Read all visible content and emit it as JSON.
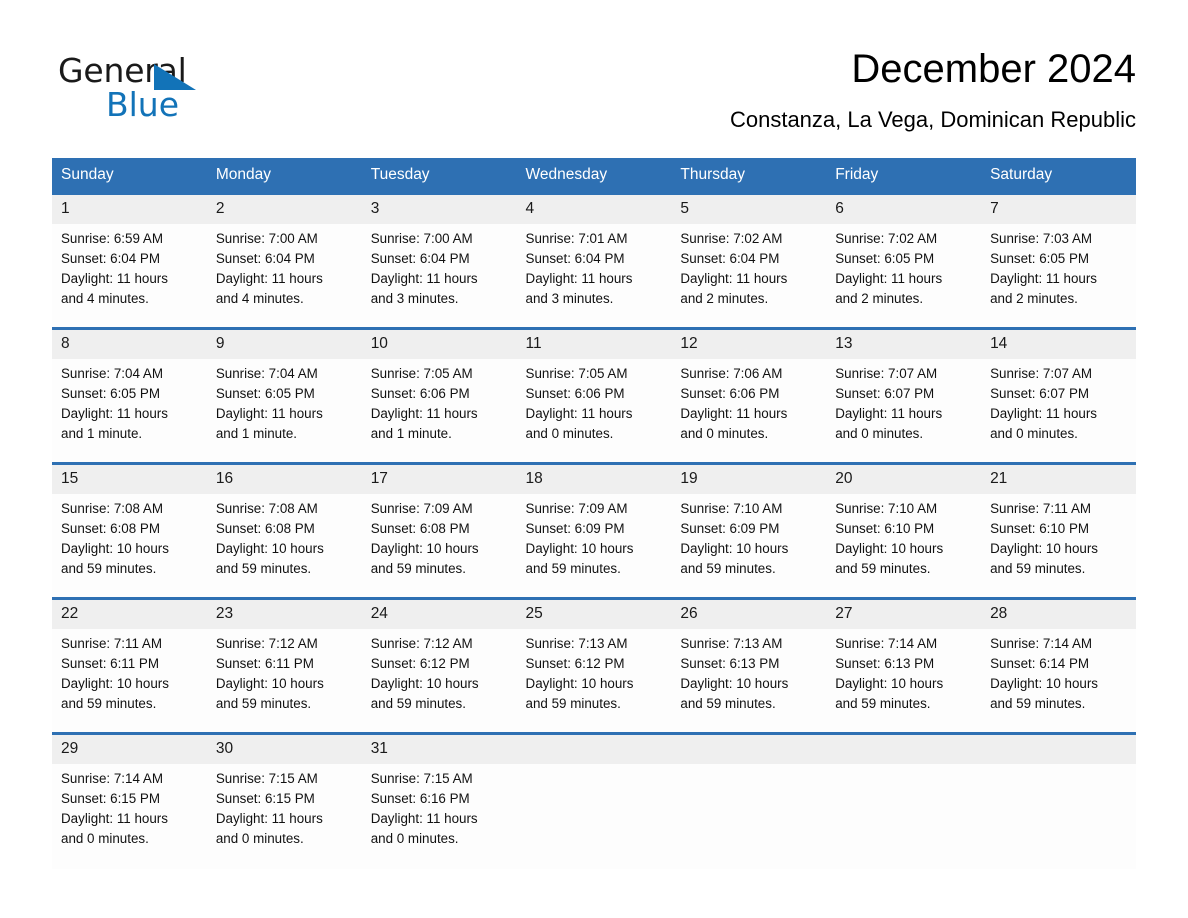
{
  "brand": {
    "name_top": "General",
    "name_bottom": "Blue",
    "triangle_icon": "triangle-logo-icon",
    "accent_color": "#1273b8"
  },
  "header": {
    "title": "December 2024",
    "subtitle": "Constanza, La Vega, Dominican Republic"
  },
  "theme": {
    "header_blue": "#2e70b3",
    "daynum_band": "#efefef",
    "cell_background": "#fdfdfd"
  },
  "weekdays": [
    "Sunday",
    "Monday",
    "Tuesday",
    "Wednesday",
    "Thursday",
    "Friday",
    "Saturday"
  ],
  "weeks": [
    [
      {
        "day": "1",
        "sunrise": "Sunrise: 6:59 AM",
        "sunset": "Sunset: 6:04 PM",
        "daylight1": "Daylight: 11 hours",
        "daylight2": "and 4 minutes."
      },
      {
        "day": "2",
        "sunrise": "Sunrise: 7:00 AM",
        "sunset": "Sunset: 6:04 PM",
        "daylight1": "Daylight: 11 hours",
        "daylight2": "and 4 minutes."
      },
      {
        "day": "3",
        "sunrise": "Sunrise: 7:00 AM",
        "sunset": "Sunset: 6:04 PM",
        "daylight1": "Daylight: 11 hours",
        "daylight2": "and 3 minutes."
      },
      {
        "day": "4",
        "sunrise": "Sunrise: 7:01 AM",
        "sunset": "Sunset: 6:04 PM",
        "daylight1": "Daylight: 11 hours",
        "daylight2": "and 3 minutes."
      },
      {
        "day": "5",
        "sunrise": "Sunrise: 7:02 AM",
        "sunset": "Sunset: 6:04 PM",
        "daylight1": "Daylight: 11 hours",
        "daylight2": "and 2 minutes."
      },
      {
        "day": "6",
        "sunrise": "Sunrise: 7:02 AM",
        "sunset": "Sunset: 6:05 PM",
        "daylight1": "Daylight: 11 hours",
        "daylight2": "and 2 minutes."
      },
      {
        "day": "7",
        "sunrise": "Sunrise: 7:03 AM",
        "sunset": "Sunset: 6:05 PM",
        "daylight1": "Daylight: 11 hours",
        "daylight2": "and 2 minutes."
      }
    ],
    [
      {
        "day": "8",
        "sunrise": "Sunrise: 7:04 AM",
        "sunset": "Sunset: 6:05 PM",
        "daylight1": "Daylight: 11 hours",
        "daylight2": "and 1 minute."
      },
      {
        "day": "9",
        "sunrise": "Sunrise: 7:04 AM",
        "sunset": "Sunset: 6:05 PM",
        "daylight1": "Daylight: 11 hours",
        "daylight2": "and 1 minute."
      },
      {
        "day": "10",
        "sunrise": "Sunrise: 7:05 AM",
        "sunset": "Sunset: 6:06 PM",
        "daylight1": "Daylight: 11 hours",
        "daylight2": "and 1 minute."
      },
      {
        "day": "11",
        "sunrise": "Sunrise: 7:05 AM",
        "sunset": "Sunset: 6:06 PM",
        "daylight1": "Daylight: 11 hours",
        "daylight2": "and 0 minutes."
      },
      {
        "day": "12",
        "sunrise": "Sunrise: 7:06 AM",
        "sunset": "Sunset: 6:06 PM",
        "daylight1": "Daylight: 11 hours",
        "daylight2": "and 0 minutes."
      },
      {
        "day": "13",
        "sunrise": "Sunrise: 7:07 AM",
        "sunset": "Sunset: 6:07 PM",
        "daylight1": "Daylight: 11 hours",
        "daylight2": "and 0 minutes."
      },
      {
        "day": "14",
        "sunrise": "Sunrise: 7:07 AM",
        "sunset": "Sunset: 6:07 PM",
        "daylight1": "Daylight: 11 hours",
        "daylight2": "and 0 minutes."
      }
    ],
    [
      {
        "day": "15",
        "sunrise": "Sunrise: 7:08 AM",
        "sunset": "Sunset: 6:08 PM",
        "daylight1": "Daylight: 10 hours",
        "daylight2": "and 59 minutes."
      },
      {
        "day": "16",
        "sunrise": "Sunrise: 7:08 AM",
        "sunset": "Sunset: 6:08 PM",
        "daylight1": "Daylight: 10 hours",
        "daylight2": "and 59 minutes."
      },
      {
        "day": "17",
        "sunrise": "Sunrise: 7:09 AM",
        "sunset": "Sunset: 6:08 PM",
        "daylight1": "Daylight: 10 hours",
        "daylight2": "and 59 minutes."
      },
      {
        "day": "18",
        "sunrise": "Sunrise: 7:09 AM",
        "sunset": "Sunset: 6:09 PM",
        "daylight1": "Daylight: 10 hours",
        "daylight2": "and 59 minutes."
      },
      {
        "day": "19",
        "sunrise": "Sunrise: 7:10 AM",
        "sunset": "Sunset: 6:09 PM",
        "daylight1": "Daylight: 10 hours",
        "daylight2": "and 59 minutes."
      },
      {
        "day": "20",
        "sunrise": "Sunrise: 7:10 AM",
        "sunset": "Sunset: 6:10 PM",
        "daylight1": "Daylight: 10 hours",
        "daylight2": "and 59 minutes."
      },
      {
        "day": "21",
        "sunrise": "Sunrise: 7:11 AM",
        "sunset": "Sunset: 6:10 PM",
        "daylight1": "Daylight: 10 hours",
        "daylight2": "and 59 minutes."
      }
    ],
    [
      {
        "day": "22",
        "sunrise": "Sunrise: 7:11 AM",
        "sunset": "Sunset: 6:11 PM",
        "daylight1": "Daylight: 10 hours",
        "daylight2": "and 59 minutes."
      },
      {
        "day": "23",
        "sunrise": "Sunrise: 7:12 AM",
        "sunset": "Sunset: 6:11 PM",
        "daylight1": "Daylight: 10 hours",
        "daylight2": "and 59 minutes."
      },
      {
        "day": "24",
        "sunrise": "Sunrise: 7:12 AM",
        "sunset": "Sunset: 6:12 PM",
        "daylight1": "Daylight: 10 hours",
        "daylight2": "and 59 minutes."
      },
      {
        "day": "25",
        "sunrise": "Sunrise: 7:13 AM",
        "sunset": "Sunset: 6:12 PM",
        "daylight1": "Daylight: 10 hours",
        "daylight2": "and 59 minutes."
      },
      {
        "day": "26",
        "sunrise": "Sunrise: 7:13 AM",
        "sunset": "Sunset: 6:13 PM",
        "daylight1": "Daylight: 10 hours",
        "daylight2": "and 59 minutes."
      },
      {
        "day": "27",
        "sunrise": "Sunrise: 7:14 AM",
        "sunset": "Sunset: 6:13 PM",
        "daylight1": "Daylight: 10 hours",
        "daylight2": "and 59 minutes."
      },
      {
        "day": "28",
        "sunrise": "Sunrise: 7:14 AM",
        "sunset": "Sunset: 6:14 PM",
        "daylight1": "Daylight: 10 hours",
        "daylight2": "and 59 minutes."
      }
    ],
    [
      {
        "day": "29",
        "sunrise": "Sunrise: 7:14 AM",
        "sunset": "Sunset: 6:15 PM",
        "daylight1": "Daylight: 11 hours",
        "daylight2": "and 0 minutes."
      },
      {
        "day": "30",
        "sunrise": "Sunrise: 7:15 AM",
        "sunset": "Sunset: 6:15 PM",
        "daylight1": "Daylight: 11 hours",
        "daylight2": "and 0 minutes."
      },
      {
        "day": "31",
        "sunrise": "Sunrise: 7:15 AM",
        "sunset": "Sunset: 6:16 PM",
        "daylight1": "Daylight: 11 hours",
        "daylight2": "and 0 minutes."
      },
      {
        "day": "",
        "sunrise": "",
        "sunset": "",
        "daylight1": "",
        "daylight2": ""
      },
      {
        "day": "",
        "sunrise": "",
        "sunset": "",
        "daylight1": "",
        "daylight2": ""
      },
      {
        "day": "",
        "sunrise": "",
        "sunset": "",
        "daylight1": "",
        "daylight2": ""
      },
      {
        "day": "",
        "sunrise": "",
        "sunset": "",
        "daylight1": "",
        "daylight2": ""
      }
    ]
  ]
}
